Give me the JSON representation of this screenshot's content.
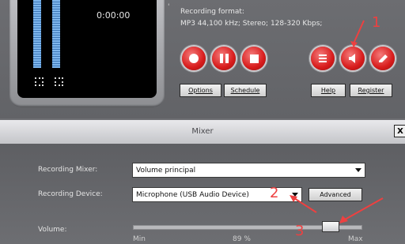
{
  "recorder": {
    "time": "0:00:00",
    "format_label": "Recording format:",
    "format_value": "MP3 44,100 kHz; Stereo;  128-320 Kbps;",
    "buttons": {
      "options": "Options",
      "schedule": "Schedule",
      "help": "Help",
      "register": "Register"
    }
  },
  "annotations": {
    "n1": "1",
    "n2": "2",
    "n3": "3"
  },
  "mixer": {
    "title": "Mixer",
    "close": "X",
    "recording_mixer_label": "Recording Mixer:",
    "recording_mixer_value": "Volume principal",
    "recording_device_label": "Recording Device:",
    "recording_device_value": "Microphone (USB Audio Device)",
    "advanced": "Advanced",
    "volume_label": "Volume:",
    "min_label": "Min",
    "volume_value": "89 %",
    "max_label": "Max",
    "volume_level": 0.89
  },
  "colors": {
    "accent": "#d81c1c",
    "annotation": "#ee4040"
  },
  "icons": [
    "record-icon",
    "pause-icon",
    "stop-icon",
    "playlist-icon",
    "speaker-icon",
    "eraser-icon"
  ]
}
